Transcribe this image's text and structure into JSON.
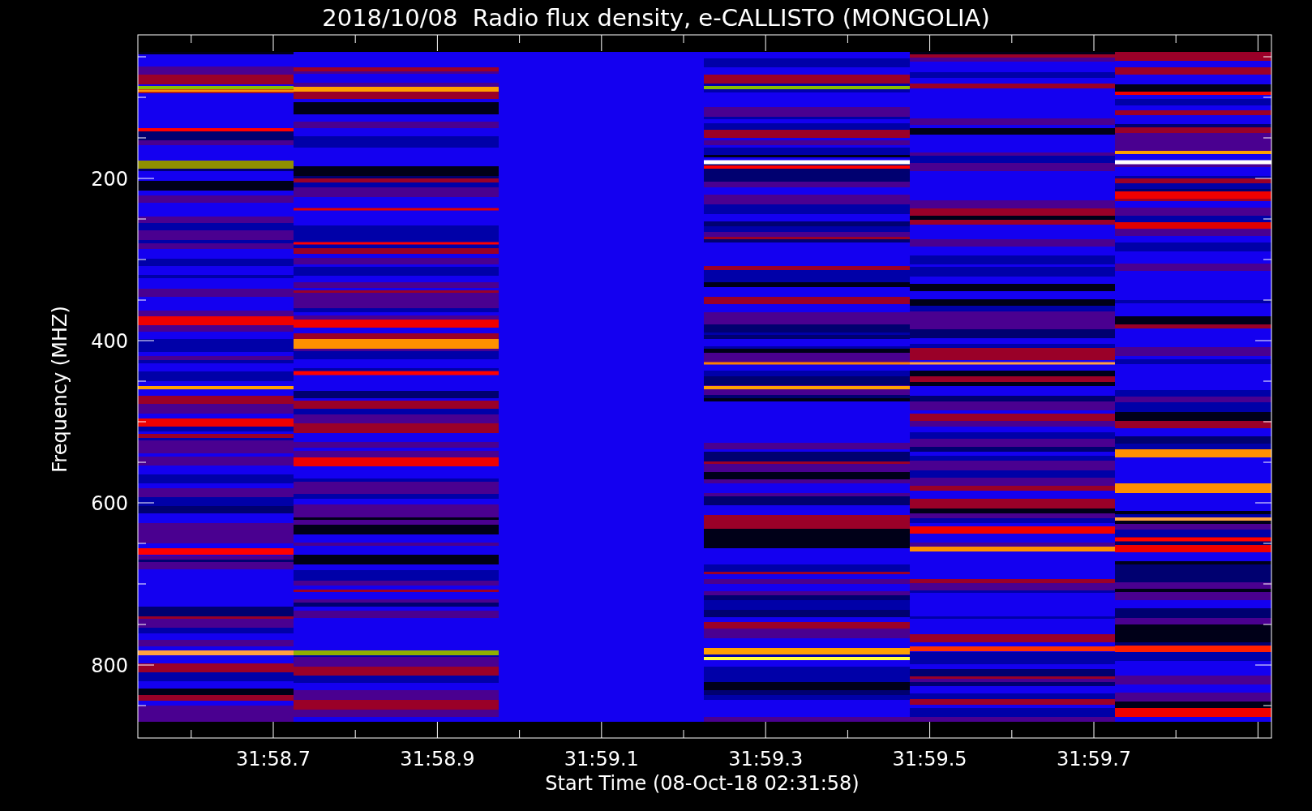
{
  "title": "2018/10/08  Radio flux density, e-CALLISTO (MONGOLIA)",
  "y_axis": {
    "label": "Frequency (MHZ)",
    "ticks": [
      "200",
      "400",
      "600",
      "800"
    ]
  },
  "x_axis": {
    "label": "Start Time (08-Oct-18 02:31:58)",
    "ticks": [
      "31:58.7",
      "31:58.9",
      "31:59.1",
      "31:59.3",
      "31:59.5",
      "31:59.7"
    ]
  }
}
